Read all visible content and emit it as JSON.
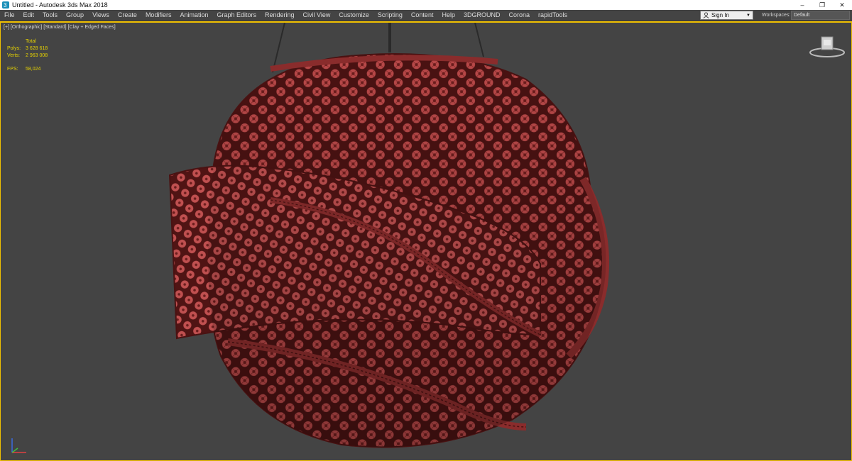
{
  "window": {
    "title": "Untitled - Autodesk 3ds Max 2018",
    "controls": {
      "minimize": "–",
      "restore": "❐",
      "close": "✕"
    }
  },
  "menubar": {
    "items": [
      "File",
      "Edit",
      "Tools",
      "Group",
      "Views",
      "Create",
      "Modifiers",
      "Animation",
      "Graph Editors",
      "Rendering",
      "Civil View",
      "Customize",
      "Scripting",
      "Content",
      "Help",
      "3DGROUND",
      "Corona",
      "rapidTools"
    ],
    "sign_in": "Sign In",
    "workspaces_label": "Workspaces:",
    "workspace_value": "Default"
  },
  "viewport": {
    "label_plus": "[+]",
    "label_view": "[Orthographic]",
    "label_shading": "[Standard]",
    "label_mode": "[Clay + Edged Faces]",
    "stats": {
      "header": "Total",
      "polys_label": "Polys:",
      "polys_value": "3 628 618",
      "verts_label": "Verts:",
      "verts_value": "2 963 008",
      "fps_label": "FPS:",
      "fps_value": "58,024"
    }
  },
  "icons": [
    "app-icon",
    "user-icon",
    "viewcube-icon",
    "axis-tripod-icon"
  ],
  "colors": {
    "viewport_bg": "#444444",
    "active_border": "#f0c000",
    "stats_text": "#e6d200",
    "model_fill": "#b84848",
    "model_wire": "#4a1212"
  }
}
